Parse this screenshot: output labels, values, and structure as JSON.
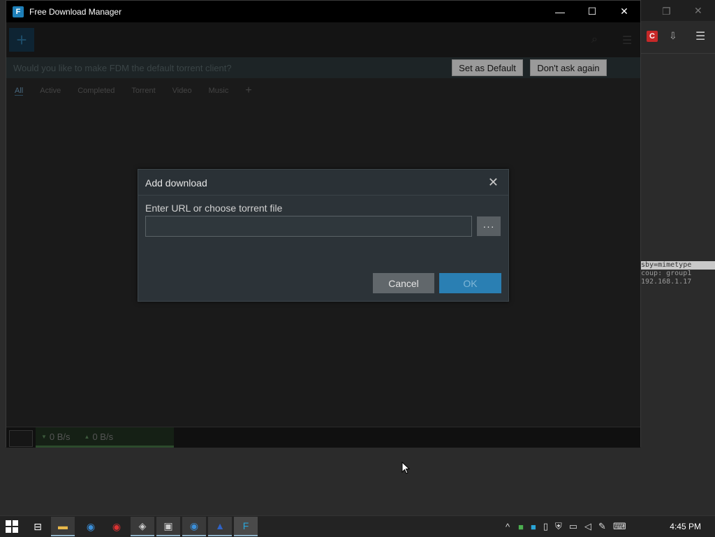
{
  "window": {
    "title": "Free Download Manager",
    "controls": {
      "minimize": "—",
      "maximize": "☐",
      "close": "✕"
    }
  },
  "toolbar": {
    "add_label": "+",
    "search_icon": "search-icon",
    "menu_icon": "menu-icon"
  },
  "notice": {
    "text": "Would you like to make FDM the default torrent client?",
    "set_default": "Set as Default",
    "dont_ask": "Don't ask again"
  },
  "tabs": [
    {
      "label": "All",
      "active": true
    },
    {
      "label": "Active"
    },
    {
      "label": "Completed"
    },
    {
      "label": "Torrent"
    },
    {
      "label": "Video"
    },
    {
      "label": "Music"
    }
  ],
  "tab_add": "+",
  "dialog": {
    "title": "Add download",
    "close": "✕",
    "url_label": "Enter URL or choose torrent file",
    "url_value": "",
    "url_placeholder": "",
    "browse": "···",
    "cancel": "Cancel",
    "ok": "OK"
  },
  "statusbar": {
    "download_speed": "0 B/s",
    "upload_speed": "0 B/s"
  },
  "background": {
    "terminal_lines": [
      "sby=mimetype",
      "coup: group1",
      "192.168.1.17"
    ]
  },
  "taskbar": {
    "time": "4:45 PM"
  },
  "colors": {
    "accent": "#2a7fb3",
    "dialog_bg": "#2c3338",
    "window_bg": "#1b1b1b"
  }
}
